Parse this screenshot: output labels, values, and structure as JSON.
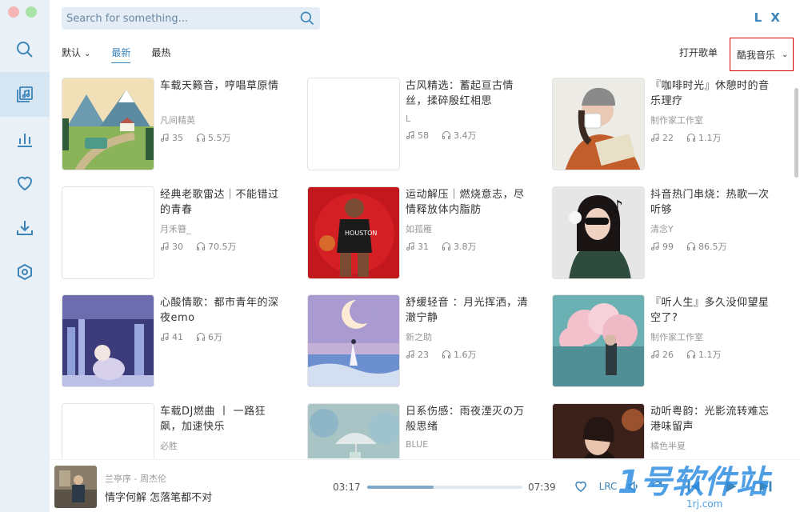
{
  "search": {
    "placeholder": "Search for something..."
  },
  "brand": "L X",
  "filters": {
    "sort_label": "默认",
    "tabs": [
      "最新",
      "最热"
    ],
    "active_tab": "最新",
    "open_list": "打开歌单",
    "source": "酷我音乐"
  },
  "playlists": [
    {
      "title": "车载天籁音，哼唱草原情",
      "author": "凡间精英",
      "songs": "35",
      "plays": "5.5万",
      "cover": "landscape-bus"
    },
    {
      "title": "古风精选：蓄起亘古情丝，揉碎殷红相思",
      "author": "L",
      "songs": "58",
      "plays": "3.4万",
      "cover": "blank"
    },
    {
      "title": "『咖啡时光』休憩时的音乐理疗",
      "author": "制作家工作室",
      "songs": "22",
      "plays": "1.1万",
      "cover": "coffee-girl"
    },
    {
      "title": "经典老歌雷达｜不能错过的青春",
      "author": "月禾簪_",
      "songs": "30",
      "plays": "70.5万",
      "cover": "blank"
    },
    {
      "title": "运动解压｜燃烧意志，尽情释放体内脂肪",
      "author": "如孤雁",
      "songs": "31",
      "plays": "3.8万",
      "cover": "basketball"
    },
    {
      "title": "抖音热门串烧：热歌一次听够",
      "author": "清念Y",
      "songs": "99",
      "plays": "86.5万",
      "cover": "tiktok-girl"
    },
    {
      "title": "心酸情歌：都市青年的深夜emo",
      "author": "",
      "songs": "41",
      "plays": "6万",
      "cover": "night-city"
    },
    {
      "title": "舒缓轻音 ：月光挥洒，清澈宁静",
      "author": "新之助",
      "songs": "23",
      "plays": "1.6万",
      "cover": "moon-sea"
    },
    {
      "title": "『听人生』多久没仰望星空了?",
      "author": "制作家工作室",
      "songs": "26",
      "plays": "1.1万",
      "cover": "pink-clouds"
    },
    {
      "title": "车载DJ燃曲 丨 一路狂飙，加速快乐",
      "author": "必胜",
      "songs": "",
      "plays": "",
      "cover": "blank"
    },
    {
      "title": "日系伤感：雨夜湮灭の万般思绪",
      "author": "BLUE",
      "songs": "",
      "plays": "",
      "cover": "rain-umbrella"
    },
    {
      "title": "动听粤韵：光影流转难忘港味留声",
      "author": "橘色半夏",
      "songs": "",
      "plays": "",
      "cover": "hk-girl"
    }
  ],
  "player": {
    "artist_line": "兰亭序 - 周杰伦",
    "lyric": "情字何解 怎落笔都不对",
    "current_time": "03:17",
    "total_time": "07:39",
    "progress": 0.43,
    "lrc_label": "LRC"
  },
  "watermark": {
    "text": "1号软件站",
    "sub": "1rj.com"
  },
  "colors": {
    "accent": "#3d84b8",
    "sidebar": "#e9f1f7",
    "source_border": "#d00000"
  }
}
